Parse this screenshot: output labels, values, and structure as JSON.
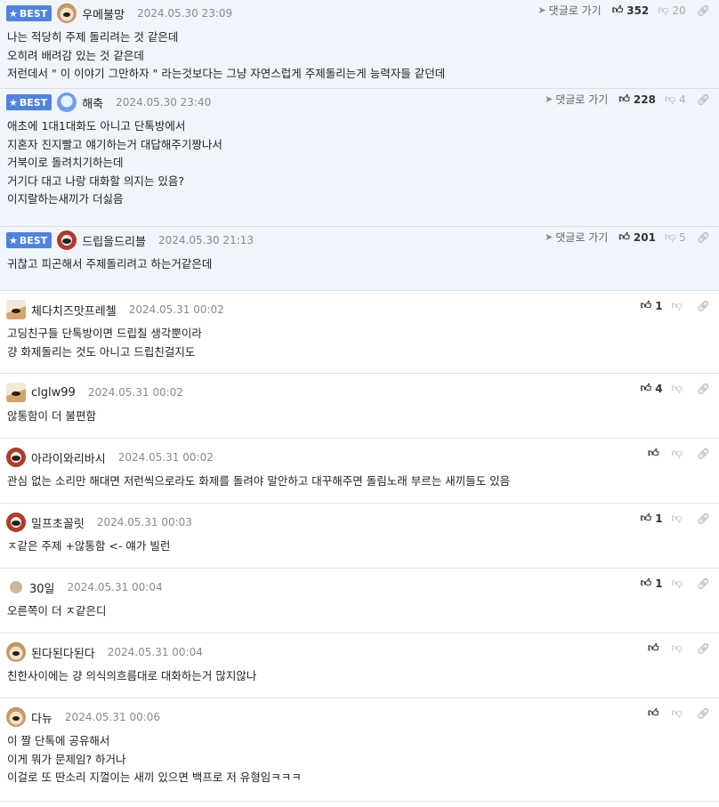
{
  "best_label": "BEST",
  "reply_label": "댓글로 가기",
  "comments": [
    {
      "best": true,
      "avatar": "dog-avatar",
      "nick": "우메불망",
      "date": "2024.05.30 23:09",
      "likes": "352",
      "dislikes": "20",
      "lines": [
        "나는 적당히 주제 돌리려는 것 같은데",
        "오히려 배려감 있는 것 같은데",
        "저런데서 \" 이 이야기 그만하자 \" 라는것보다는 그냥 자연스럽게 주제돌리는게 능력자들 같던데"
      ]
    },
    {
      "best": true,
      "avatar": "blue-avatar",
      "nick": "해축",
      "date": "2024.05.30 23:40",
      "likes": "228",
      "dislikes": "4",
      "lines": [
        "애초에 1대1대화도 아니고 단톡방에서",
        "지혼자 진지빨고 얘기하는거 대답해주기짱나서",
        "거북이로 돌려치기하는데",
        "거기다 대고 나랑 대화할 의지는 있음?",
        "이지랄하는새끼가 더싫음"
      ]
    },
    {
      "best": true,
      "avatar": "red-avatar",
      "nick": "드립을드리블",
      "date": "2024.05.30 21:13",
      "likes": "201",
      "dislikes": "5",
      "lines": [
        "귀찮고 피곤해서 주제돌리려고 하는거같은데"
      ]
    },
    {
      "best": false,
      "avatar": "fox-avatar",
      "nick": "체다치즈맛프레첼",
      "date": "2024.05.31 00:02",
      "likes": "1",
      "dislikes": "",
      "lines": [
        "고딩친구들 단톡방이면 드립칠 생각뿐이라",
        "걍 화제돌리는 것도 아니고 드립친걸지도"
      ]
    },
    {
      "best": false,
      "avatar": "fox-avatar",
      "nick": "clglw99",
      "date": "2024.05.31 00:02",
      "likes": "4",
      "dislikes": "",
      "lines": [
        "않통함이 더 불편함"
      ]
    },
    {
      "best": false,
      "avatar": "red-avatar",
      "nick": "아라이와리바시",
      "date": "2024.05.31 00:02",
      "likes": "",
      "dislikes": "",
      "lines": [
        "관심 없는 소리만 해대면 저런씩으로라도 화제를 돌려야 말안하고 대꾸해주면 돌림노래 부르는 새끼들도 있음"
      ]
    },
    {
      "best": false,
      "avatar": "red-avatar",
      "nick": "밀프초꼴릿",
      "date": "2024.05.31 00:03",
      "likes": "1",
      "dislikes": "",
      "lines": [
        "ㅈ같은 주제 +않통함 <- 얘가 빌런"
      ]
    },
    {
      "best": false,
      "avatar": "circle-avatar",
      "nick": "30일",
      "date": "2024.05.31 00:04",
      "likes": "1",
      "dislikes": "",
      "lines": [
        "오른쪽이 더 ㅈ같은디"
      ]
    },
    {
      "best": false,
      "avatar": "dog-avatar",
      "nick": "된다된다된다",
      "date": "2024.05.31 00:04",
      "likes": "",
      "dislikes": "",
      "lines": [
        "친한사이에는 걍 의식의흐름대로 대화하는거 많지않나"
      ]
    },
    {
      "best": false,
      "avatar": "dog-avatar",
      "nick": "다뉴",
      "date": "2024.05.31 00:06",
      "likes": "",
      "dislikes": "",
      "lines": [
        "이 짤 단톡에 공유해서",
        "이게 뭐가 문제임? 하거나",
        "이걸로 또 딴소리 지껄이는 새끼 있으면 백프로 저 유형임ㅋㅋㅋ"
      ]
    }
  ]
}
